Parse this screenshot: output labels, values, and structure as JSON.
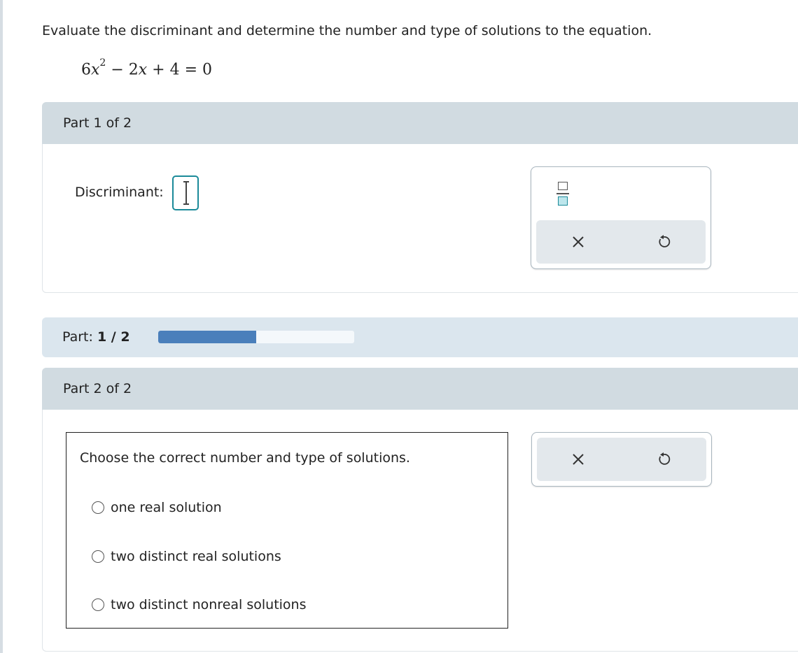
{
  "problem": {
    "instruction": "Evaluate the discriminant and determine the number and type of solutions to the equation.",
    "equation": {
      "coef_a": "6",
      "var1": "x",
      "exponent": "2",
      "mid": " − 2",
      "var2": "x",
      "rest": " + 4 = 0"
    }
  },
  "part1": {
    "header": "Part 1 of 2",
    "discriminant_label": "Discriminant:",
    "discriminant_value": "",
    "tools": [
      "fraction-icon",
      "clear-icon",
      "undo-icon"
    ]
  },
  "progress": {
    "label": "Part: ",
    "current": "1 / 2",
    "fraction_complete": 0.5,
    "fill_color": "#4a7fbb"
  },
  "part2": {
    "header": "Part 2 of 2",
    "prompt": "Choose the correct number and type of solutions.",
    "options": [
      "one real solution",
      "two distinct real solutions",
      "two distinct nonreal solutions"
    ],
    "selected": null,
    "tools": [
      "clear-icon",
      "undo-icon"
    ]
  },
  "colors": {
    "accent": "#1b8a99",
    "header_bg": "#d1dbe1",
    "progress_bg": "#dbe6ee"
  }
}
